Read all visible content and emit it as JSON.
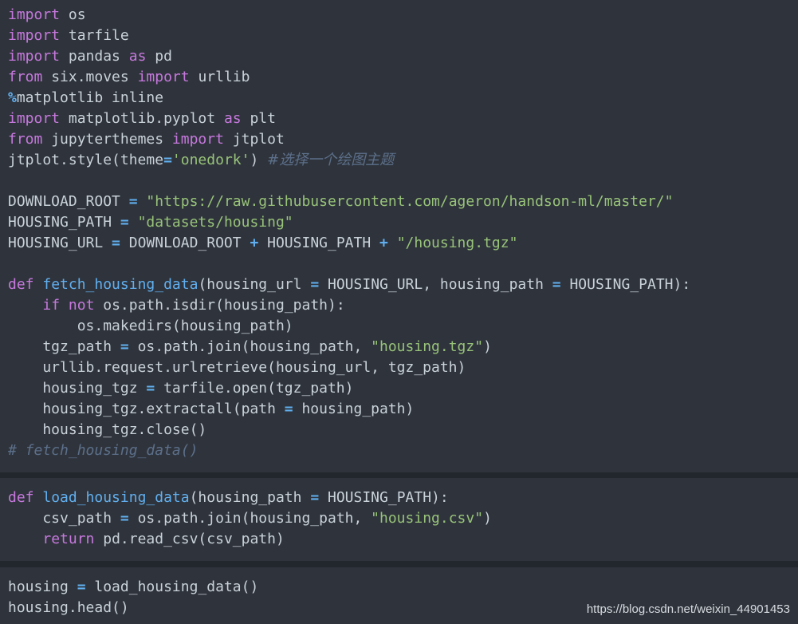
{
  "cells": {
    "cell1": {
      "l1": [
        "import",
        " os"
      ],
      "l2": [
        "import",
        " tarfile"
      ],
      "l3": [
        "import",
        " pandas ",
        "as",
        " pd"
      ],
      "l4": [
        "from",
        " six.moves ",
        "import",
        " urllib"
      ],
      "l5": [
        "%",
        "matplotlib inline"
      ],
      "l6": [
        "import",
        " matplotlib.pyplot ",
        "as",
        " plt"
      ],
      "l7": [
        "from",
        " jupyterthemes ",
        "import",
        " jtplot"
      ],
      "l8": [
        "jtplot.style(theme",
        "=",
        "'onedork'",
        ") ",
        "#选择一个绘图主题"
      ],
      "l10": [
        "DOWNLOAD_ROOT ",
        "=",
        " ",
        "\"https://raw.githubusercontent.com/ageron/handson-ml/master/\""
      ],
      "l11": [
        "HOUSING_PATH ",
        "=",
        " ",
        "\"datasets/housing\""
      ],
      "l12": [
        "HOUSING_URL ",
        "=",
        " DOWNLOAD_ROOT ",
        "+",
        " HOUSING_PATH ",
        "+",
        " ",
        "\"/housing.tgz\""
      ],
      "l14": [
        "def",
        " ",
        "fetch_housing_data",
        "(housing_url ",
        "=",
        " HOUSING_URL, housing_path ",
        "=",
        " HOUSING_PATH):"
      ],
      "l15": [
        "    ",
        "if",
        " ",
        "not",
        " os.path.isdir(housing_path):"
      ],
      "l16": [
        "        os.makedirs(housing_path)"
      ],
      "l17": [
        "    tgz_path ",
        "=",
        " os.path.join(housing_path, ",
        "\"housing.tgz\"",
        ")"
      ],
      "l18": [
        "    urllib.request.urlretrieve(housing_url, tgz_path)"
      ],
      "l19": [
        "    housing_tgz ",
        "=",
        " tarfile.open(tgz_path)"
      ],
      "l20": [
        "    housing_tgz.extractall(path ",
        "=",
        " housing_path)"
      ],
      "l21": [
        "    housing_tgz.close()"
      ],
      "l22": [
        "# fetch_housing_data()"
      ]
    },
    "cell2": {
      "l1": [
        "def",
        " ",
        "load_housing_data",
        "(housing_path ",
        "=",
        " HOUSING_PATH):"
      ],
      "l2": [
        "    csv_path ",
        "=",
        " os.path.join(housing_path, ",
        "\"housing.csv\"",
        ")"
      ],
      "l3": [
        "    ",
        "return",
        " pd.read_csv(csv_path)"
      ]
    },
    "cell3": {
      "l1": [
        "housing ",
        "=",
        " load_housing_data()"
      ],
      "l2": [
        "housing.head()"
      ]
    }
  },
  "watermark": "https://blog.csdn.net/weixin_44901453",
  "colors": {
    "background": "#22272e",
    "cell": "#2f343c",
    "text": "#c9d1d9",
    "keyword": "#c678dd",
    "string": "#98c379",
    "function": "#61afef",
    "operator": "#61afef",
    "comment": "#5c6f8a"
  }
}
